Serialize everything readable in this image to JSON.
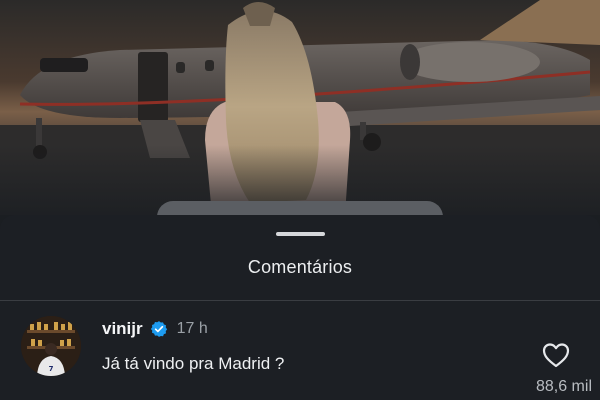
{
  "sheet": {
    "title": "Comentários"
  },
  "comment": {
    "username": "vinijr",
    "verified_icon": "verified-badge-icon",
    "time": "17 h",
    "text": "Já tá vindo pra Madrid ?",
    "like_icon": "heart-outline-icon",
    "like_count": "88,6 mil"
  },
  "colors": {
    "sheet_bg": "#1c1f24",
    "verified": "#1d9bf0",
    "muted_text": "#9aa0a6"
  }
}
